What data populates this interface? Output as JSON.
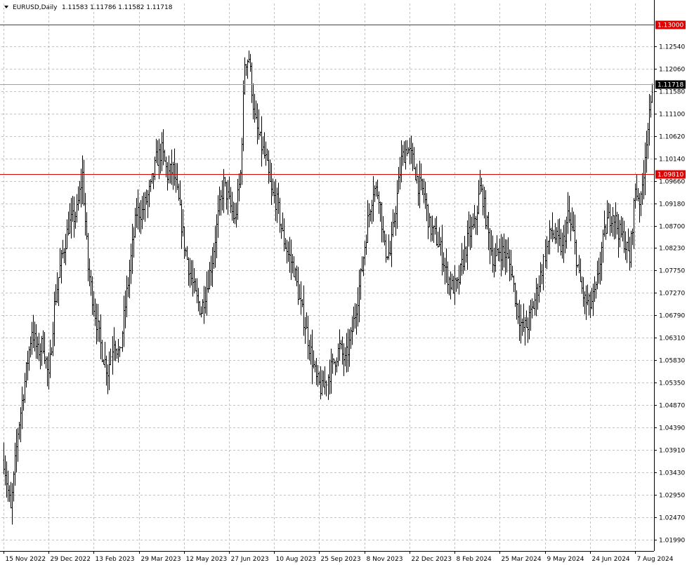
{
  "header": {
    "symbol_label": "EURUSD,Daily",
    "ohlc_label": "1.11583 1.11786 1.11582 1.11718",
    "dropdown_icon": "triangle-down-icon"
  },
  "colors": {
    "background": "#ffffff",
    "grid": "#c0c0c0",
    "bars": "#000000",
    "level_line": "#e00000",
    "price_line": "#a0a0a0",
    "current_price_tag": "#000000"
  },
  "chart_data": {
    "type": "ohlc",
    "title": "EURUSD,Daily",
    "ylim": [
      1.0175,
      1.1345
    ],
    "y_ticks": [
      1.1254,
      1.1206,
      1.1158,
      1.111,
      1.1062,
      1.1014,
      1.0966,
      1.0918,
      1.087,
      1.0823,
      1.0775,
      1.0727,
      1.0679,
      1.0631,
      1.0583,
      1.0535,
      1.0487,
      1.0439,
      1.0391,
      1.0343,
      1.0295,
      1.0247,
      1.0199
    ],
    "y_tick_labels": [
      "1.12540",
      "1.12060",
      "1.11580",
      "1.11100",
      "1.10620",
      "1.10140",
      "1.09660",
      "1.09180",
      "1.08700",
      "1.08230",
      "1.07750",
      "1.07270",
      "1.06790",
      "1.06310",
      "1.05830",
      "1.05350",
      "1.04870",
      "1.04390",
      "1.03910",
      "1.03430",
      "1.02950",
      "1.02470",
      "1.01990"
    ],
    "x_tick_labels": [
      "15 Nov 2022",
      "29 Dec 2022",
      "13 Feb 2023",
      "29 Mar 2023",
      "12 May 2023",
      "27 Jun 2023",
      "10 Aug 2023",
      "25 Sep 2023",
      "8 Nov 2023",
      "22 Dec 2023",
      "8 Feb 2024",
      "25 Mar 2024",
      "9 May 2024",
      "24 Jun 2024",
      "7 Aug 2024"
    ],
    "x_tick_index": [
      0,
      32,
      64,
      96,
      128,
      160,
      192,
      224,
      256,
      288,
      320,
      352,
      384,
      416,
      448
    ],
    "bar_count": 461,
    "horizontal_levels": [
      {
        "value": 1.13,
        "label": "1.13000",
        "color": "#e00000"
      },
      {
        "value": 1.0981,
        "label": "1.09810",
        "color": "#e00000"
      }
    ],
    "current_price": {
      "value": 1.11718,
      "label": "1.11718"
    },
    "anchors": [
      [
        0,
        1.037
      ],
      [
        5,
        1.026
      ],
      [
        10,
        1.043
      ],
      [
        16,
        1.056
      ],
      [
        20,
        1.065
      ],
      [
        24,
        1.06
      ],
      [
        28,
        1.062
      ],
      [
        32,
        1.054
      ],
      [
        36,
        1.07
      ],
      [
        40,
        1.078
      ],
      [
        46,
        1.087
      ],
      [
        52,
        1.09
      ],
      [
        56,
        1.098
      ],
      [
        60,
        1.078
      ],
      [
        64,
        1.07
      ],
      [
        70,
        1.06
      ],
      [
        74,
        1.056
      ],
      [
        78,
        1.063
      ],
      [
        82,
        1.059
      ],
      [
        86,
        1.07
      ],
      [
        90,
        1.08
      ],
      [
        94,
        1.09
      ],
      [
        98,
        1.09
      ],
      [
        104,
        1.095
      ],
      [
        108,
        1.101
      ],
      [
        112,
        1.103
      ],
      [
        116,
        1.098
      ],
      [
        120,
        1.099
      ],
      [
        124,
        1.092
      ],
      [
        128,
        1.083
      ],
      [
        132,
        1.077
      ],
      [
        136,
        1.072
      ],
      [
        140,
        1.069
      ],
      [
        144,
        1.074
      ],
      [
        148,
        1.08
      ],
      [
        152,
        1.089
      ],
      [
        156,
        1.096
      ],
      [
        160,
        1.092
      ],
      [
        164,
        1.088
      ],
      [
        168,
        1.098
      ],
      [
        171,
        1.122
      ],
      [
        174,
        1.123
      ],
      [
        178,
        1.11
      ],
      [
        182,
        1.105
      ],
      [
        186,
        1.101
      ],
      [
        190,
        1.094
      ],
      [
        194,
        1.092
      ],
      [
        198,
        1.085
      ],
      [
        202,
        1.081
      ],
      [
        206,
        1.078
      ],
      [
        210,
        1.071
      ],
      [
        214,
        1.066
      ],
      [
        218,
        1.06
      ],
      [
        222,
        1.054
      ],
      [
        226,
        1.052
      ],
      [
        230,
        1.055
      ],
      [
        234,
        1.058
      ],
      [
        238,
        1.061
      ],
      [
        242,
        1.058
      ],
      [
        246,
        1.063
      ],
      [
        250,
        1.07
      ],
      [
        254,
        1.078
      ],
      [
        258,
        1.088
      ],
      [
        262,
        1.095
      ],
      [
        266,
        1.094
      ],
      [
        270,
        1.082
      ],
      [
        274,
        1.081
      ],
      [
        278,
        1.091
      ],
      [
        282,
        1.101
      ],
      [
        286,
        1.104
      ],
      [
        290,
        1.101
      ],
      [
        294,
        1.096
      ],
      [
        298,
        1.094
      ],
      [
        302,
        1.087
      ],
      [
        306,
        1.085
      ],
      [
        310,
        1.082
      ],
      [
        314,
        1.077
      ],
      [
        318,
        1.074
      ],
      [
        322,
        1.074
      ],
      [
        326,
        1.08
      ],
      [
        330,
        1.085
      ],
      [
        334,
        1.087
      ],
      [
        338,
        1.095
      ],
      [
        340,
        1.093
      ],
      [
        344,
        1.085
      ],
      [
        348,
        1.079
      ],
      [
        352,
        1.082
      ],
      [
        356,
        1.081
      ],
      [
        360,
        1.078
      ],
      [
        364,
        1.07
      ],
      [
        368,
        1.065
      ],
      [
        372,
        1.066
      ],
      [
        376,
        1.07
      ],
      [
        380,
        1.075
      ],
      [
        384,
        1.081
      ],
      [
        388,
        1.086
      ],
      [
        392,
        1.084
      ],
      [
        396,
        1.082
      ],
      [
        400,
        1.089
      ],
      [
        404,
        1.085
      ],
      [
        408,
        1.076
      ],
      [
        412,
        1.071
      ],
      [
        416,
        1.07
      ],
      [
        420,
        1.073
      ],
      [
        424,
        1.082
      ],
      [
        428,
        1.088
      ],
      [
        432,
        1.09
      ],
      [
        436,
        1.086
      ],
      [
        440,
        1.084
      ],
      [
        444,
        1.08
      ],
      [
        448,
        1.095
      ],
      [
        452,
        1.092
      ],
      [
        456,
        1.106
      ],
      [
        459,
        1.112
      ],
      [
        460,
        1.1172
      ]
    ]
  }
}
